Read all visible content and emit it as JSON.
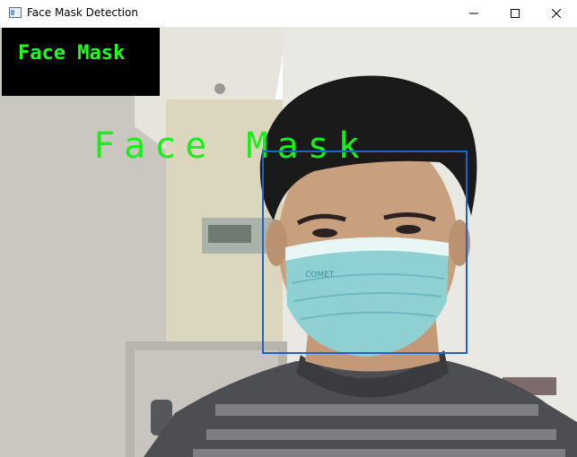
{
  "window": {
    "title": "Face Mask Detection",
    "controls": [
      "minimize",
      "maximize",
      "close"
    ]
  },
  "detection": {
    "status_label": "Face Mask",
    "box_label": "Face Mask"
  },
  "colors": {
    "label_text": "#1eff1e",
    "label_background": "#000000",
    "bounding_box": "#1e64c8"
  }
}
